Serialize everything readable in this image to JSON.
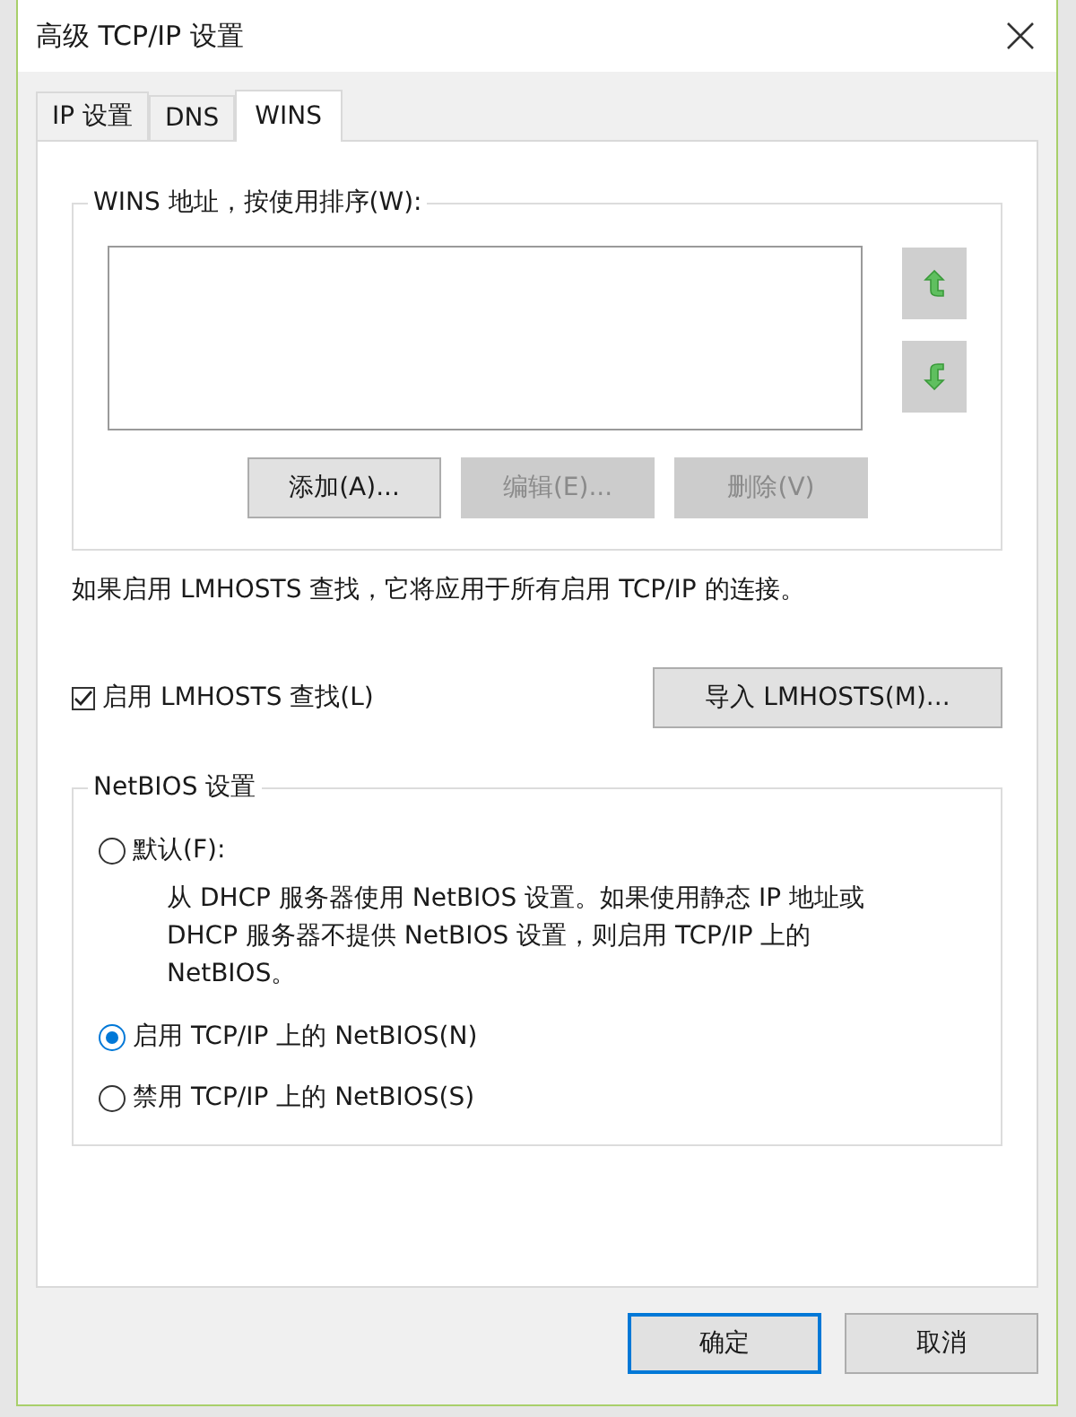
{
  "window": {
    "title": "高级 TCP/IP 设置"
  },
  "tabs": [
    {
      "label": "IP 设置",
      "selected": false
    },
    {
      "label": "DNS",
      "selected": false
    },
    {
      "label": "WINS",
      "selected": true
    }
  ],
  "wins_group": {
    "title": "WINS 地址，按使用排序(W):",
    "buttons": [
      {
        "label": "添加(A)...",
        "disabled": false
      },
      {
        "label": "编辑(E)...",
        "disabled": true
      },
      {
        "label": "删除(V)",
        "disabled": true
      }
    ]
  },
  "lmhosts": {
    "info": "如果启用 LMHOSTS 查找，它将应用于所有启用 TCP/IP 的连接。",
    "checkbox": {
      "label": "启用 LMHOSTS 查找(L)",
      "checked": true
    },
    "import_button": "导入 LMHOSTS(M)..."
  },
  "netbios": {
    "title": "NetBIOS 设置",
    "options": [
      {
        "label": "默认(F):",
        "selected": false,
        "description": "从 DHCP 服务器使用 NetBIOS 设置。如果使用静态 IP 地址或 DHCP 服务器不提供 NetBIOS 设置，则启用 TCP/IP 上的 NetBIOS。"
      },
      {
        "label": "启用 TCP/IP 上的 NetBIOS(N)",
        "selected": true
      },
      {
        "label": "禁用 TCP/IP 上的 NetBIOS(S)",
        "selected": false
      }
    ]
  },
  "footer_buttons": [
    "确定",
    "取消"
  ]
}
